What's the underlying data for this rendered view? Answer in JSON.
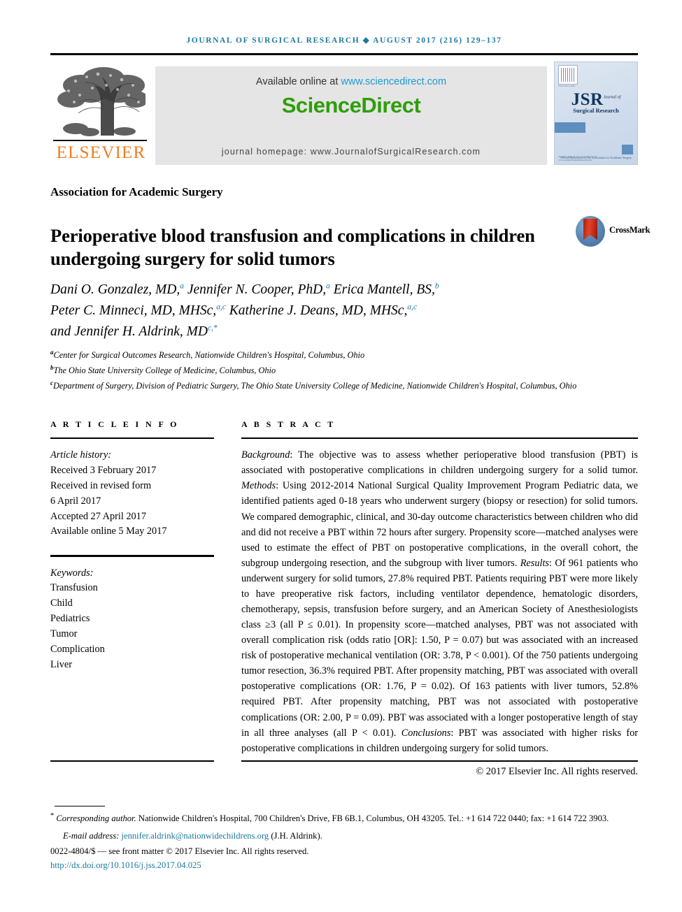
{
  "running_head": "JOURNAL OF SURGICAL RESEARCH ◆ AUGUST 2017 (216) 129–137",
  "masthead": {
    "publisher_name": "ELSEVIER",
    "available_prefix": "Available online at ",
    "available_url": "www.sciencedirect.com",
    "wordmark": "ScienceDirect",
    "homepage": "journal homepage: www.JournalofSurgicalResearch.com",
    "cover": {
      "title": "JSR",
      "title_sup": "Journal of",
      "subtitle": "Surgical Research",
      "issn": "ISSN 0022-4804",
      "association": "Official Publication of the\nAssociation for Academic Surgery",
      "footer_line1": "Available online at www.sciencedirect.com",
      "footer_line2": "www.JournalofSurgicalResearch.com"
    }
  },
  "society_line": "Association for Academic Surgery",
  "title": "Perioperative blood transfusion and complications in children undergoing surgery for solid tumors",
  "crossmark": {
    "label": "CrossMark"
  },
  "authors": {
    "line1_a": "Dani O. Gonzalez, MD,",
    "line1_a_sup": "a",
    "line1_b": " Jennifer N. Cooper, PhD,",
    "line1_b_sup": "a",
    "line1_c": " Erica Mantell, BS,",
    "line1_c_sup": "b",
    "line2_a": "Peter C. Minneci, MD, MHSc,",
    "line2_a_sup": "a,c",
    "line2_b": " Katherine J. Deans, MD, MHSc,",
    "line2_b_sup": "a,c",
    "line3_a": "and Jennifer H. Aldrink, MD",
    "line3_a_sup": "c,*"
  },
  "affiliations": [
    {
      "mark": "a",
      "text": "Center for Surgical Outcomes Research, Nationwide Children's Hospital, Columbus, Ohio"
    },
    {
      "mark": "b",
      "text": "The Ohio State University College of Medicine, Columbus, Ohio"
    },
    {
      "mark": "c",
      "text": "Department of Surgery, Division of Pediatric Surgery, The Ohio State University College of Medicine, Nationwide Children's Hospital, Columbus, Ohio"
    }
  ],
  "article_info": {
    "heading": "A R T I C L E   I N F O",
    "history_label": "Article history:",
    "history": [
      "Received 3 February 2017",
      "Received in revised form",
      "6 April 2017",
      "Accepted 27 April 2017",
      "Available online 5 May 2017"
    ],
    "keywords_label": "Keywords:",
    "keywords": [
      "Transfusion",
      "Child",
      "Pediatrics",
      "Tumor",
      "Complication",
      "Liver"
    ]
  },
  "abstract": {
    "heading": "A B S T R A C T",
    "background_label": "Background",
    "background_text": ": The objective was to assess whether perioperative blood transfusion (PBT) is associated with postoperative complications in children undergoing surgery for a solid tumor.",
    "methods_label": "Methods",
    "methods_text": ": Using 2012-2014 National Surgical Quality Improvement Program Pediatric data, we identified patients aged 0-18 years who underwent surgery (biopsy or resection) for solid tumors. We compared demographic, clinical, and 30-day outcome characteristics between children who did and did not receive a PBT within 72 hours after surgery. Propensity score—matched analyses were used to estimate the effect of PBT on postoperative complications, in the overall cohort, the subgroup undergoing resection, and the subgroup with liver tumors.",
    "results_label": "Results",
    "results_text": ": Of 961 patients who underwent surgery for solid tumors, 27.8% required PBT. Patients requiring PBT were more likely to have preoperative risk factors, including ventilator dependence, hematologic disorders, chemotherapy, sepsis, transfusion before surgery, and an American Society of Anesthesiologists class ≥3 (all P ≤ 0.01). In propensity score—matched analyses, PBT was not associated with overall complication risk (odds ratio [OR]: 1.50, P = 0.07) but was associated with an increased risk of postoperative mechanical ventilation (OR: 3.78, P < 0.001). Of the 750 patients undergoing tumor resection, 36.3% required PBT. After propensity matching, PBT was associated with overall postoperative complications (OR: 1.76, P = 0.02). Of 163 patients with liver tumors, 52.8% required PBT. After propensity matching, PBT was not associated with postoperative complications (OR: 2.00, P = 0.09). PBT was associated with a longer postoperative length of stay in all three analyses (all P < 0.01).",
    "conclusions_label": "Conclusions",
    "conclusions_text": ": PBT was associated with higher risks for postoperative complications in children undergoing surgery for solid tumors.",
    "copyright": "© 2017 Elsevier Inc. All rights reserved."
  },
  "footnotes": {
    "corresponding_mark": "*",
    "corresponding_label": "Corresponding author.",
    "corresponding_text": " Nationwide Children's Hospital, 700 Children's Drive, FB 6B.1, Columbus, OH 43205. Tel.: +1 614 722 0440; fax: +1 614 722 3903.",
    "email_label": "E-mail address:",
    "email": "jennifer.aldrink@nationwidechildrens.org",
    "email_suffix": " (J.H. Aldrink).",
    "issn_line": "0022-4804/$ — see front matter © 2017 Elsevier Inc. All rights reserved.",
    "doi": "http://dx.doi.org/10.1016/j.jss.2017.04.025"
  },
  "colors": {
    "link": "#1a7a9e",
    "sciencedirect_green": "#2e9e0a",
    "elsevier_orange": "#f07d21",
    "banner_gray": "#e5e5e5"
  }
}
